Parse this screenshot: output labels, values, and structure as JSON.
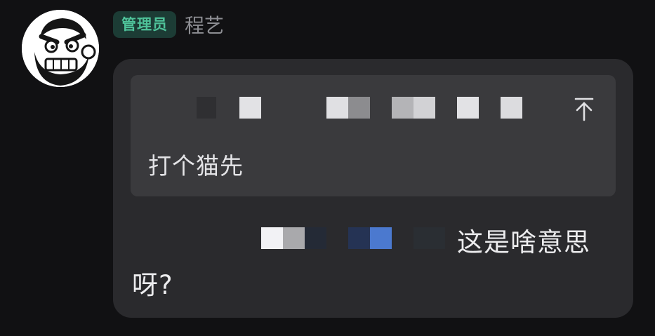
{
  "sender": {
    "role_badge": "管理员",
    "name": "程艺",
    "avatar_icon": "cartoon-face-avatar-icon"
  },
  "message": {
    "quote": {
      "text": "打个猫先",
      "jump_icon": "jump-to-top-icon"
    },
    "text_line1": "这是啥意思",
    "text_line2": "呀?"
  },
  "colors": {
    "background": "#111113",
    "bubble": "#2a2a2d",
    "quote_bg": "#3a3a3d",
    "badge_bg": "#1c3c35",
    "badge_text": "#4fc39a",
    "name_text": "#8d8e93"
  }
}
